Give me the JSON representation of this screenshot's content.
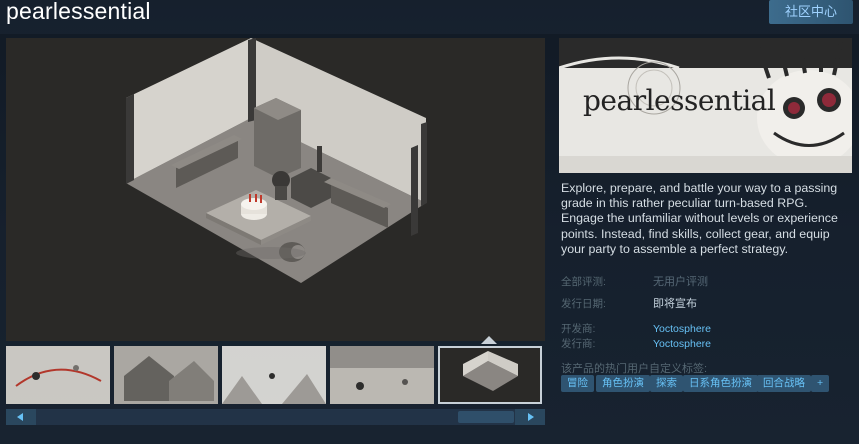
{
  "header": {
    "title": "pearlessential",
    "community_hub_label": "社区中心"
  },
  "capsule": {
    "logo_text": "pearlessential"
  },
  "description": "Explore, prepare, and battle your way to a passing grade in this rather peculiar turn-based RPG. Engage the unfamiliar without levels or experience points. Instead, find skills, collect gear, and equip your party to assemble a perfect strategy.",
  "reviews": {
    "label": "全部评测:",
    "value": "无用户评测"
  },
  "release": {
    "label": "发行日期:",
    "value": "即将宣布"
  },
  "developer": {
    "label": "开发商:",
    "value": "Yoctosphere"
  },
  "publisher": {
    "label": "发行商:",
    "value": "Yoctosphere"
  },
  "tags": {
    "label": "该产品的热门用户自定义标签:",
    "items": [
      "冒险",
      "角色扮演",
      "探索",
      "日系角色扮演",
      "回合战略",
      "+"
    ]
  },
  "media": {
    "thumbnail_count": 5,
    "selected_index": 4
  },
  "colors": {
    "background": "#1b2838",
    "accent": "#66c0f4",
    "tag_bg": "#2f5471"
  }
}
